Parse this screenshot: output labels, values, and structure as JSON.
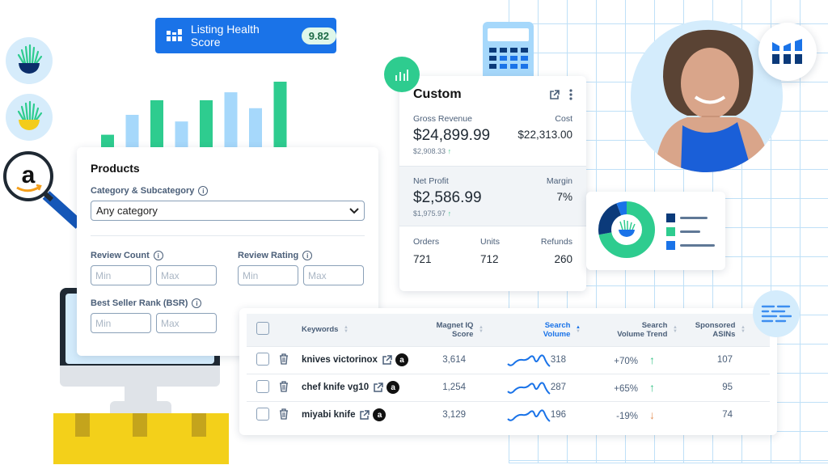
{
  "listing_health": {
    "label": "Listing Health Score",
    "score": "9.82",
    "icon": "bar-chart-logo-icon"
  },
  "bar_chart": {
    "values": [
      1.0,
      2.5,
      3.6,
      2.0,
      3.6,
      4.2,
      3.0,
      5.0
    ],
    "colors": [
      "#2ecc8f",
      "#a6d8fb",
      "#2ecc8f",
      "#a6d8fb",
      "#2ecc8f",
      "#a6d8fb",
      "#a6d8fb",
      "#2ecc8f"
    ]
  },
  "products": {
    "title": "Products",
    "category_label": "Category & Subcategory",
    "category_value": "Any category",
    "review_count_label": "Review Count",
    "review_rating_label": "Review Rating",
    "bsr_label": "Best Seller Rank (BSR)",
    "min_placeholder": "Min",
    "max_placeholder": "Max"
  },
  "custom": {
    "title": "Custom",
    "gross_revenue_label": "Gross Revenue",
    "gross_revenue": "$24,899.99",
    "gross_revenue_prev": "$2,908.33",
    "cost_label": "Cost",
    "cost": "$22,313.00",
    "net_profit_label": "Net Profit",
    "net_profit": "$2,586.99",
    "net_profit_prev": "$1,975.97",
    "margin_label": "Margin",
    "margin": "7%",
    "orders_label": "Orders",
    "orders": "721",
    "units_label": "Units",
    "units": "712",
    "refunds_label": "Refunds",
    "refunds": "260"
  },
  "donut": {
    "segments": [
      {
        "color": "#0b3a7a",
        "fraction": 0.22
      },
      {
        "color": "#1a73e8",
        "fraction": 0.06
      },
      {
        "color": "#2ecc8f",
        "fraction": 0.72
      }
    ]
  },
  "keywords_table": {
    "headers": {
      "keywords": "Keywords",
      "magnet_iq_1": "Magnet IQ",
      "magnet_iq_2": "Score",
      "search_volume_1": "Search",
      "search_volume_2": "Volume",
      "svt_1": "Search",
      "svt_2": "Volume Trend",
      "sponsored_1": "Sponsored",
      "sponsored_2": "ASINs"
    },
    "rows": [
      {
        "keyword": "knives victorinox",
        "score": "3,614",
        "volume": "318",
        "trend": "+70%",
        "trend_dir": "up",
        "asins": "107"
      },
      {
        "keyword": "chef knife vg10",
        "score": "1,254",
        "volume": "287",
        "trend": "+65%",
        "trend_dir": "up",
        "asins": "95"
      },
      {
        "keyword": "miyabi knife",
        "score": "3,129",
        "volume": "196",
        "trend": "-19%",
        "trend_dir": "down",
        "asins": "74"
      }
    ]
  },
  "colors": {
    "brand_blue": "#1a73e8",
    "green": "#2ecc8f",
    "light_blue": "#a6d8fb",
    "navy": "#0b3a7a",
    "up_arrow": "#3cc48a",
    "down_arrow": "#e4925a"
  }
}
